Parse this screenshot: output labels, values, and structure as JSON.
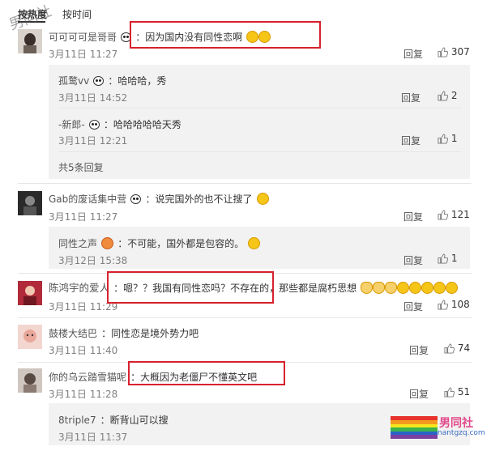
{
  "tabs": {
    "hot": "按热度",
    "time": "按时间"
  },
  "watermark": {
    "top_left": "男同社",
    "logo": "男同社",
    "site": "nantgzq.com"
  },
  "comments": [
    {
      "user": "可可可可是哥哥",
      "text": "：因为国内没有同性恋啊",
      "time": "3月11日 11:27",
      "reply": "回复",
      "likes": "307",
      "replies": [
        {
          "user": "孤鹜vv",
          "text": "：哈哈哈，秀",
          "time": "3月11日 14:52",
          "reply": "回复",
          "likes": "2"
        },
        {
          "user": "-新郎-",
          "text": "：哈哈哈哈哈天秀",
          "time": "3月11日 12:21",
          "reply": "回复",
          "likes": "1"
        }
      ],
      "more": "共5条回复"
    },
    {
      "user": "Gab的废话集中营",
      "text": "：说完国外的也不让搜了",
      "time": "3月11日 11:27",
      "reply": "回复",
      "likes": "121",
      "replies": [
        {
          "user": "同性之声",
          "text": "：不可能，国外都是包容的。",
          "time": "3月12日 15:38",
          "reply": "回复",
          "likes": "1"
        }
      ]
    },
    {
      "user": "陈鸿宇的爱人",
      "text": "：嗯？？我国有同性恋吗？不存在的，那些都是腐朽思想",
      "time": "3月11日 11:29",
      "reply": "回复",
      "likes": "108"
    },
    {
      "user": "鼓楼大结巴",
      "text": "：同性恋是境外势力吧",
      "time": "3月11日 11:40",
      "reply": "回复",
      "likes": "74"
    },
    {
      "user": "你的乌云踏雪猫呢",
      "text": "：大概因为老僵尸不懂英文吧",
      "time": "3月11日 11:28",
      "reply": "回复",
      "likes": "51",
      "replies": [
        {
          "user": "8triple7",
          "text": "：断背山可以搜",
          "time": "3月11日 11:37"
        }
      ]
    }
  ],
  "colors": {
    "highlight": "#d8212d",
    "reply_bg": "#f2f2f2",
    "link": "#555555"
  }
}
